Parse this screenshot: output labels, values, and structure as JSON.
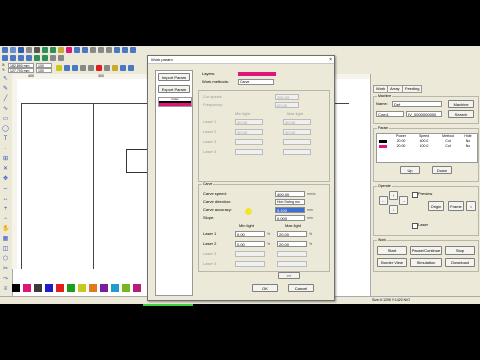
{
  "toolbar": {
    "coord_x_value": "182.890 mm",
    "coord_y_value": "127.793 mm",
    "zoom_value": "100",
    "x_label": "X:",
    "y_label": "Y:"
  },
  "ruler": {
    "h_labels": [
      "400",
      "300",
      "200"
    ]
  },
  "work_params": {
    "title": "Work param",
    "close": "×",
    "import_button": "Import Param",
    "export_button": "Export Param",
    "list_item": "Color",
    "layers_label": "Layers:",
    "layer_color": "#e0157a",
    "work_methods_label": "Work methods:",
    "work_method_value": "Carve",
    "cut_speed_label": "Cut speed:",
    "cut_speed_value": "200.00",
    "frequency_label": "Frequency:",
    "frequency_value": "20.00",
    "min_light_header": "Min light",
    "max_light_header": "Max light",
    "laser_rows": [
      {
        "label": "Laser 1",
        "min": "20.00",
        "max": "20.00"
      },
      {
        "label": "Laser 2",
        "min": "20.00",
        "max": "20.00"
      },
      {
        "label": "Laser 3",
        "min": "",
        "max": ""
      },
      {
        "label": "Laser 4",
        "min": "",
        "max": ""
      }
    ],
    "carve_group": "Carve",
    "carve_speed_label": "Carve speed:",
    "carve_speed_value": "400.00",
    "carve_speed_unit": "mm/s",
    "carve_direction_label": "Carve direction:",
    "carve_direction_value": "Hori Swing mo",
    "carve_accuracy_label": "Carve accuracy:",
    "carve_accuracy_value": "0.100",
    "carve_accuracy_unit": "mm",
    "slope_label": "Slope:",
    "slope_value": "0.000",
    "slope_unit": "mm",
    "carve_lasers": [
      {
        "label": "Laser 1",
        "min": "0.00",
        "max": "20.00"
      },
      {
        "label": "Laser 2",
        "min": "0.00",
        "max": "20.00"
      },
      {
        "label": "Laser 3",
        "min": "",
        "max": ""
      },
      {
        "label": "Laser 4",
        "min": "",
        "max": ""
      }
    ],
    "percent": "%",
    "more_button": ">>",
    "ok_button": "OK",
    "cancel_button": "Cancel"
  },
  "work_panel": {
    "tabs": [
      "Work",
      "Array",
      "Feeding"
    ],
    "machine_label": "Machine",
    "name_label": "Name:",
    "name_value": "Def",
    "machine_button": "Machine",
    "port_value": "Com1",
    "ip_value": "IV_0000000000",
    "search_button": "Search",
    "params_label": "Param",
    "param_headers": [
      "Power",
      "Speed",
      "Method",
      "Hide"
    ],
    "param_rows": [
      {
        "color": "#000000",
        "power": "20.00",
        "speed": "400.0",
        "method": "Cut",
        "hide": "No"
      },
      {
        "color": "#e0157a",
        "power": "20.00",
        "speed": "100.0",
        "method": "Cut",
        "hide": "No"
      }
    ],
    "up_button": "Up",
    "down_button": "Down",
    "operate_label": "Operate",
    "preview_label": "Preview",
    "origin_button": "Origin",
    "frame_button": "Frame",
    "laser_label": "Laser",
    "work_label": "Work",
    "start_button": "Start",
    "pause_button": "Pause/Continue",
    "stop_button": "Stop",
    "border_view_button": "Border View",
    "simulation_button": "Simulation",
    "download_button": "Download"
  },
  "palette": [
    "#000000",
    "#e0157a",
    "#3a3a3a",
    "#1e1ec8",
    "#e01e1e",
    "#1e9e1e",
    "#c8c81e",
    "#e07a1e",
    "#7a1e9e",
    "#1e9ec8",
    "#7ab41e",
    "#b41e7a"
  ],
  "status": {
    "coords": "Size:X:1205 Y:1420 N/O"
  }
}
